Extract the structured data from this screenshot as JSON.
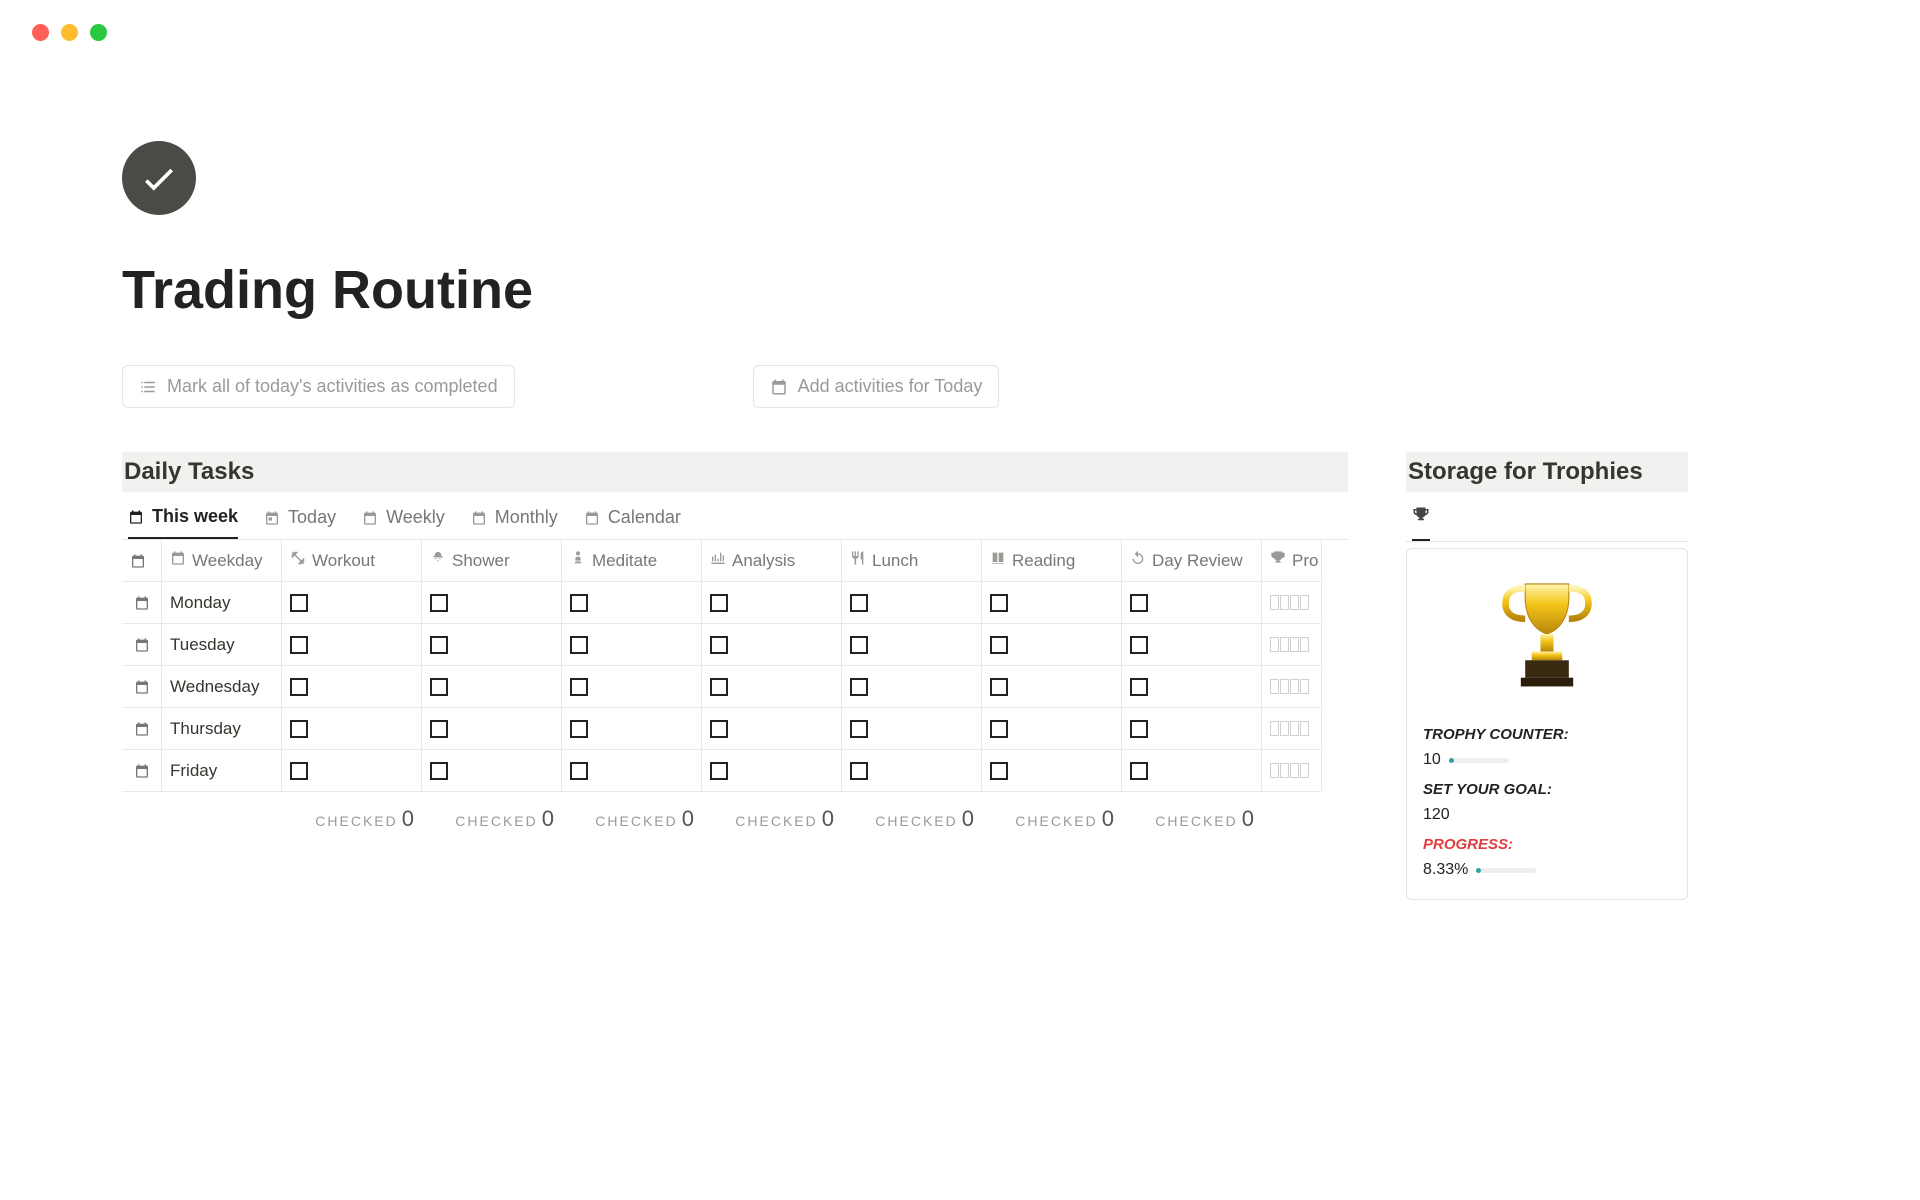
{
  "page_title": "Trading Routine",
  "actions": {
    "mark_all": "Mark all of today's activities as completed",
    "add_today": "Add activities for Today"
  },
  "daily_tasks": {
    "heading": "Daily Tasks",
    "tabs": [
      "This week",
      "Today",
      "Weekly",
      "Monthly",
      "Calendar"
    ],
    "active_tab": 0,
    "columns": [
      "Weekday",
      "Workout",
      "Shower",
      "Meditate",
      "Analysis",
      "Lunch",
      "Reading",
      "Day Review",
      "Pro"
    ],
    "rows": [
      "Monday",
      "Tuesday",
      "Wednesday",
      "Thursday",
      "Friday"
    ],
    "footer_label": "CHECKED",
    "footer_values": [
      0,
      0,
      0,
      0,
      0,
      0,
      0
    ]
  },
  "trophies": {
    "heading": "Storage for Trophies",
    "counter_label": "TROPHY COUNTER:",
    "counter_value": "10",
    "goal_label": "SET YOUR GOAL:",
    "goal_value": "120",
    "progress_label": "PROGRESS:",
    "progress_value": "8.33%",
    "progress_pct": 8.33
  }
}
